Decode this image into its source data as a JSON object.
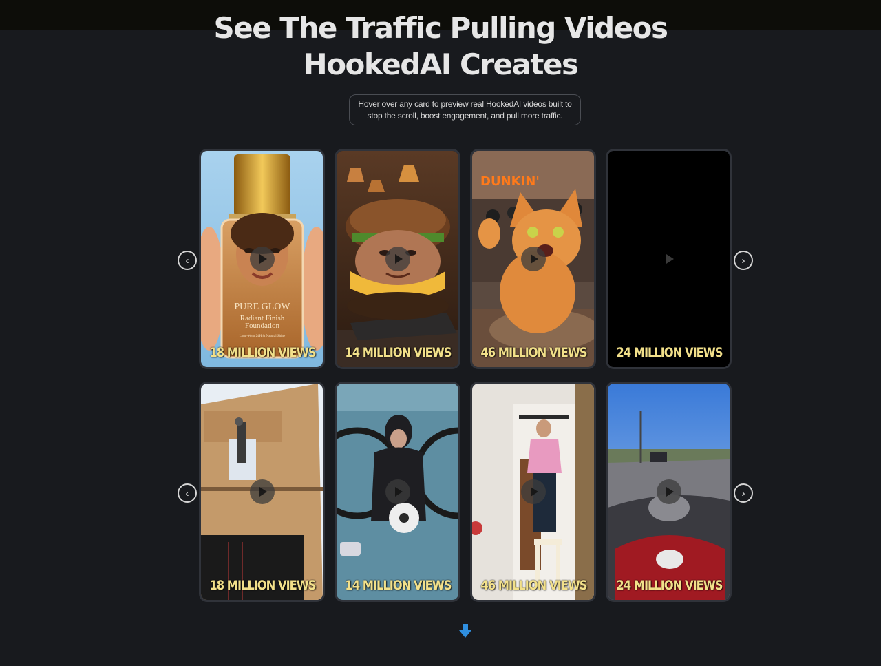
{
  "header": {
    "title_line1": "See The Traffic Pulling Videos",
    "title_line2": "HookedAI Creates",
    "subtitle_line1": "Hover over any card to preview real HookedAI videos built to",
    "subtitle_line2": "stop the scroll, boost engagement, and pull more traffic."
  },
  "rows": [
    {
      "cards": [
        {
          "views": "18 MILLION VIEWS",
          "label_line1": "PURE GLOW",
          "label_line2": "Radiant Finish",
          "label_line3": "Foundation",
          "label_line4": "Long-Wear 24H & Natural Shine"
        },
        {
          "views": "14 MILLION VIEWS"
        },
        {
          "views": "46 MILLION VIEWS",
          "sign": "DUNKIN'"
        },
        {
          "views": "24 MILLION VIEWS"
        }
      ]
    },
    {
      "cards": [
        {
          "views": "18 MILLION VIEWS"
        },
        {
          "views": "14 MILLION VIEWS"
        },
        {
          "views": "46 MILLION VIEWS"
        },
        {
          "views": "24 MILLION VIEWS"
        }
      ]
    }
  ],
  "nav": {
    "prev_icon": "chevron-left-icon",
    "next_icon": "chevron-right-icon",
    "prev_glyph": "‹",
    "next_glyph": "›"
  },
  "scroll_icon": "arrow-down-icon",
  "colors": {
    "background": "#181a1e",
    "views_text": "#f2e08a",
    "accent": "#2f8fe0"
  }
}
